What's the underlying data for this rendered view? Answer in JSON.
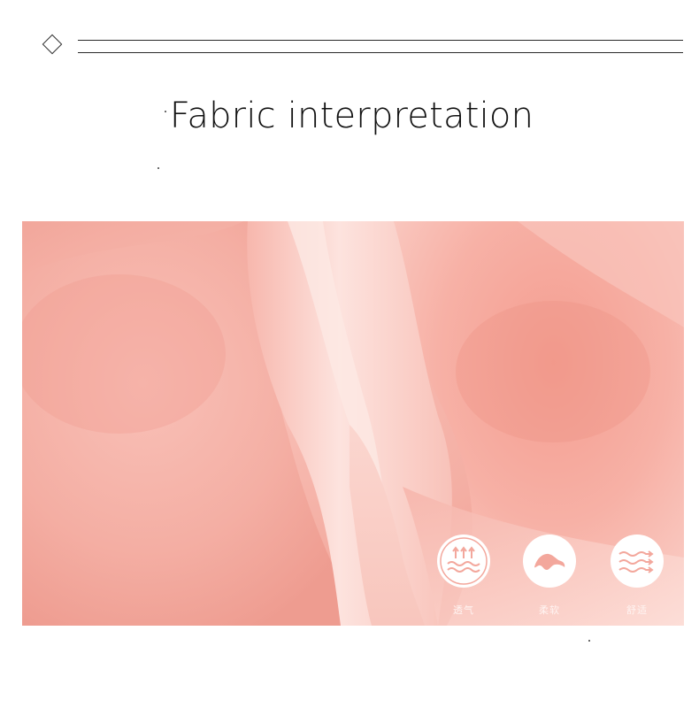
{
  "header": {
    "title": "Fabric interpretation"
  },
  "features": [
    {
      "icon": "breathable-waves-icon",
      "label": "透气"
    },
    {
      "icon": "soft-cloud-icon",
      "label": "柔软"
    },
    {
      "icon": "comfort-wind-icon",
      "label": "舒适"
    }
  ],
  "colors": {
    "fabric": "#f7b7ad",
    "fabric_highlight": "#fde1dc",
    "fabric_shadow": "#ef9e92",
    "icon_stroke": "#f3a79c"
  }
}
